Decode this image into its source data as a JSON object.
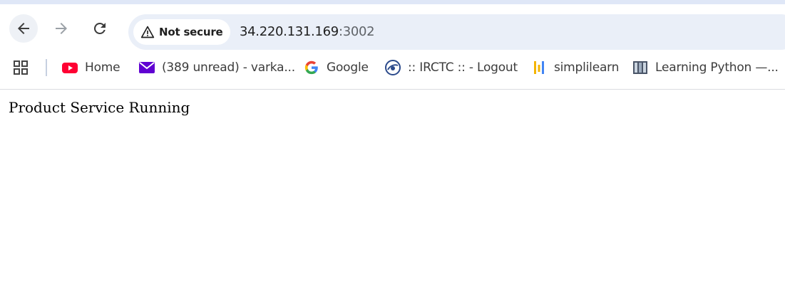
{
  "toolbar": {
    "security_chip": {
      "label": "Not secure",
      "icon": "warning-triangle-icon"
    },
    "address": {
      "host": "34.220.131.169",
      "port": ":3002"
    }
  },
  "bookmarks": [
    {
      "label": "Home",
      "icon": "youtube-icon"
    },
    {
      "label": "(389 unread) - varka...",
      "icon": "yahoo-mail-icon"
    },
    {
      "label": "Google",
      "icon": "google-icon"
    },
    {
      "label": ":: IRCTC :: - Logout",
      "icon": "irctc-icon"
    },
    {
      "label": "simplilearn",
      "icon": "simplilearn-icon"
    },
    {
      "label": "Learning Python —...",
      "icon": "book-icon"
    }
  ],
  "page": {
    "body_text": "Product Service Running"
  },
  "colors": {
    "accent": "#dfe7f7",
    "omnibox": "#eaeff8",
    "youtube": "#ff0033",
    "mail": "#6001d2"
  }
}
